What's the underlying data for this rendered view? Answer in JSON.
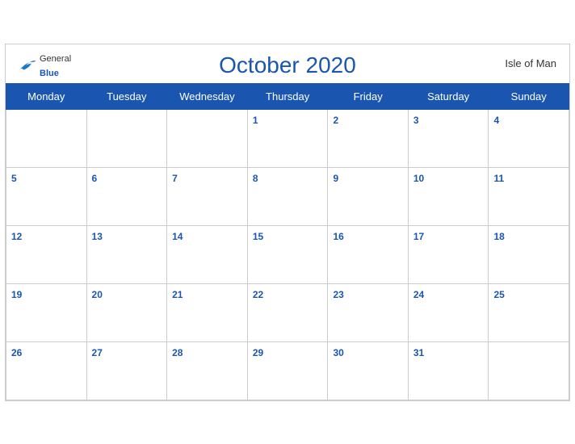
{
  "header": {
    "logo_general": "General",
    "logo_blue": "Blue",
    "title": "October 2020",
    "region": "Isle of Man"
  },
  "days_of_week": [
    "Monday",
    "Tuesday",
    "Wednesday",
    "Thursday",
    "Friday",
    "Saturday",
    "Sunday"
  ],
  "weeks": [
    [
      null,
      null,
      null,
      1,
      2,
      3,
      4
    ],
    [
      5,
      6,
      7,
      8,
      9,
      10,
      11
    ],
    [
      12,
      13,
      14,
      15,
      16,
      17,
      18
    ],
    [
      19,
      20,
      21,
      22,
      23,
      24,
      25
    ],
    [
      26,
      27,
      28,
      29,
      30,
      31,
      null
    ]
  ]
}
